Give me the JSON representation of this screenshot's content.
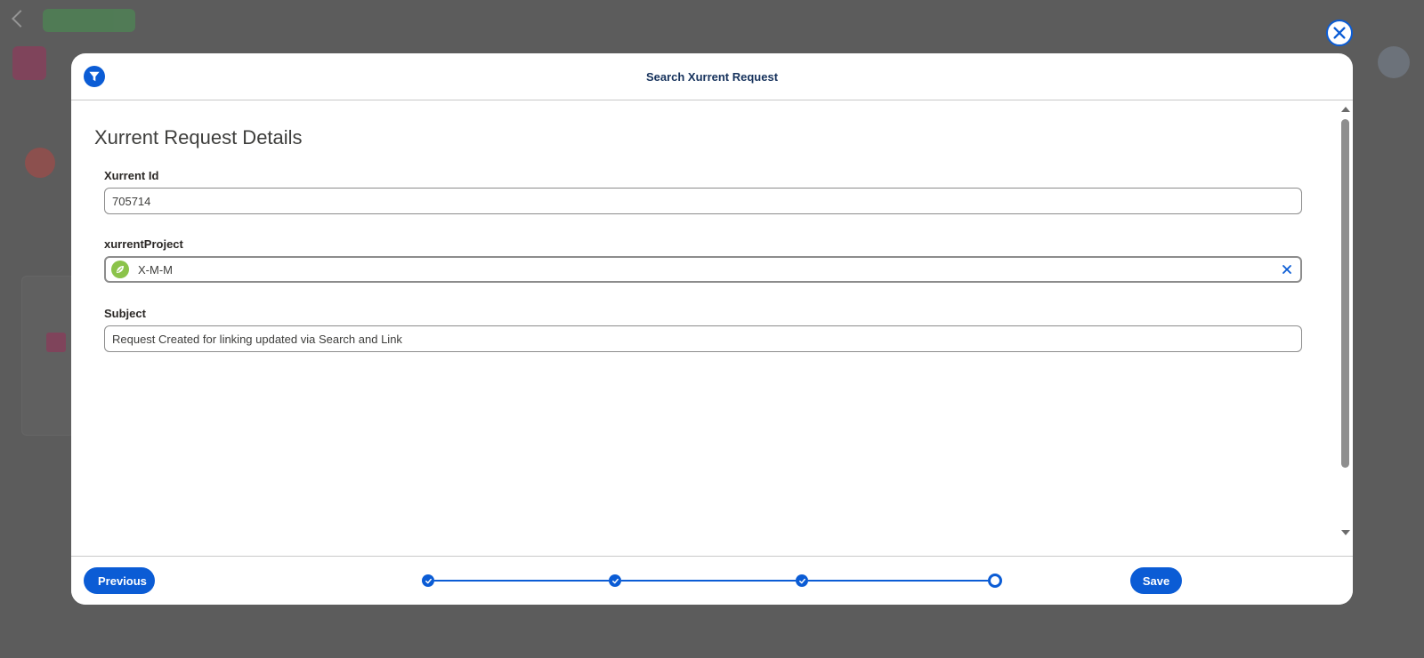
{
  "modal": {
    "title": "Search Xurrent Request",
    "section_title": "Xurrent Request Details"
  },
  "fields": {
    "xurrent_id": {
      "label": "Xurrent Id",
      "value": "705714"
    },
    "xurrent_project": {
      "label": "xurrentProject",
      "value": "X-M-M"
    },
    "subject": {
      "label": "Subject",
      "value": "Request Created for linking updated via Search and Link"
    }
  },
  "footer": {
    "previous_label": "Previous",
    "save_label": "Save",
    "progress": {
      "completed_steps": 3,
      "total_steps": 4,
      "current_step": 4
    }
  },
  "icons": {
    "close": "close-icon",
    "filter": "filter-icon",
    "lookup": "leaf-icon",
    "clear": "clear-icon",
    "check": "check-icon"
  },
  "colors": {
    "accent": "#0b5cd5",
    "overlay": "#5c5c5c",
    "lookup_icon": "#8bc34a"
  }
}
